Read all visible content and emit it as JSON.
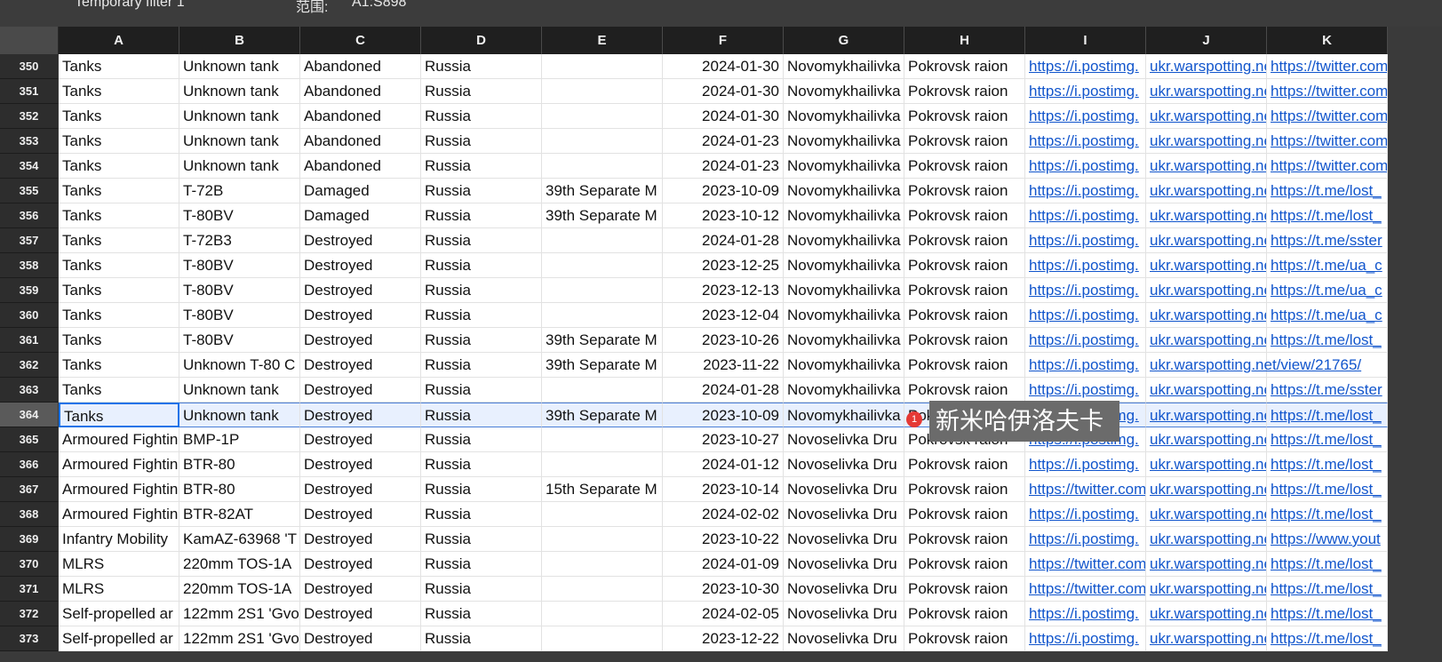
{
  "filter_bar": {
    "filter_name": "Temporary filter 1",
    "range_label": "范围:",
    "range_value": "A1:S898"
  },
  "columns": [
    "A",
    "B",
    "C",
    "D",
    "E",
    "F",
    "G",
    "H",
    "I",
    "J",
    "K"
  ],
  "tooltip": {
    "text": "新米哈伊洛夫卡",
    "badge": "1"
  },
  "rows": [
    {
      "num": "350",
      "cells": [
        "Tanks",
        "Unknown tank",
        "Abandoned",
        "Russia",
        "",
        "2024-01-30",
        "Novomykhailivka",
        "Pokrovsk raion",
        "https://i.postimg.",
        "ukr.warspotting.net",
        "https://twitter.com"
      ]
    },
    {
      "num": "351",
      "cells": [
        "Tanks",
        "Unknown tank",
        "Abandoned",
        "Russia",
        "",
        "2024-01-30",
        "Novomykhailivka",
        "Pokrovsk raion",
        "https://i.postimg.",
        "ukr.warspotting.net",
        "https://twitter.com"
      ]
    },
    {
      "num": "352",
      "cells": [
        "Tanks",
        "Unknown tank",
        "Abandoned",
        "Russia",
        "",
        "2024-01-30",
        "Novomykhailivka",
        "Pokrovsk raion",
        "https://i.postimg.",
        "ukr.warspotting.net",
        "https://twitter.com"
      ]
    },
    {
      "num": "353",
      "cells": [
        "Tanks",
        "Unknown tank",
        "Abandoned",
        "Russia",
        "",
        "2024-01-23",
        "Novomykhailivka",
        "Pokrovsk raion",
        "https://i.postimg.",
        "ukr.warspotting.net",
        "https://twitter.com"
      ]
    },
    {
      "num": "354",
      "cells": [
        "Tanks",
        "Unknown tank",
        "Abandoned",
        "Russia",
        "",
        "2024-01-23",
        "Novomykhailivka",
        "Pokrovsk raion",
        "https://i.postimg.",
        "ukr.warspotting.net",
        "https://twitter.com"
      ]
    },
    {
      "num": "355",
      "cells": [
        "Tanks",
        "T-72B",
        "Damaged",
        "Russia",
        "39th Separate M",
        "2023-10-09",
        "Novomykhailivka",
        "Pokrovsk raion",
        "https://i.postimg.",
        "ukr.warspotting.net",
        "https://t.me/lost_"
      ]
    },
    {
      "num": "356",
      "cells": [
        "Tanks",
        "T-80BV",
        "Damaged",
        "Russia",
        "39th Separate M",
        "2023-10-12",
        "Novomykhailivka",
        "Pokrovsk raion",
        "https://i.postimg.",
        "ukr.warspotting.net",
        "https://t.me/lost_"
      ]
    },
    {
      "num": "357",
      "cells": [
        "Tanks",
        "T-72B3",
        "Destroyed",
        "Russia",
        "",
        "2024-01-28",
        "Novomykhailivka",
        "Pokrovsk raion",
        "https://i.postimg.",
        "ukr.warspotting.net",
        "https://t.me/sster"
      ]
    },
    {
      "num": "358",
      "cells": [
        "Tanks",
        "T-80BV",
        "Destroyed",
        "Russia",
        "",
        "2023-12-25",
        "Novomykhailivka",
        "Pokrovsk raion",
        "https://i.postimg.",
        "ukr.warspotting.net",
        "https://t.me/ua_c"
      ]
    },
    {
      "num": "359",
      "cells": [
        "Tanks",
        "T-80BV",
        "Destroyed",
        "Russia",
        "",
        "2023-12-13",
        "Novomykhailivka",
        "Pokrovsk raion",
        "https://i.postimg.",
        "ukr.warspotting.net",
        "https://t.me/ua_c"
      ]
    },
    {
      "num": "360",
      "cells": [
        "Tanks",
        "T-80BV",
        "Destroyed",
        "Russia",
        "",
        "2023-12-04",
        "Novomykhailivka",
        "Pokrovsk raion",
        "https://i.postimg.",
        "ukr.warspotting.net",
        "https://t.me/ua_c"
      ]
    },
    {
      "num": "361",
      "cells": [
        "Tanks",
        "T-80BV",
        "Destroyed",
        "Russia",
        "39th Separate M",
        "2023-10-26",
        "Novomykhailivka",
        "Pokrovsk raion",
        "https://i.postimg.",
        "ukr.warspotting.net",
        "https://t.me/lost_"
      ]
    },
    {
      "num": "362",
      "cells": [
        "Tanks",
        "Unknown T-80 C",
        "Destroyed",
        "Russia",
        "39th Separate M",
        "2023-11-22",
        "Novomykhailivka",
        "Pokrovsk raion",
        "https://i.postimg.",
        "ukr.warspotting.net/view/21765/",
        ""
      ]
    },
    {
      "num": "363",
      "cells": [
        "Tanks",
        "Unknown tank",
        "Destroyed",
        "Russia",
        "",
        "2024-01-28",
        "Novomykhailivka",
        "Pokrovsk raion",
        "https://i.postimg.",
        "ukr.warspotting.net",
        "https://t.me/sster"
      ]
    },
    {
      "num": "364",
      "cells": [
        "Tanks",
        "Unknown tank",
        "Destroyed",
        "Russia",
        "39th Separate M",
        "2023-10-09",
        "Novomykhailivka",
        "Pokrovsk raion",
        "https://i.postimg.",
        "ukr.warspotting.net",
        "https://t.me/lost_"
      ]
    },
    {
      "num": "365",
      "cells": [
        "Armoured Fightin",
        "BMP-1P",
        "Destroyed",
        "Russia",
        "",
        "2023-10-27",
        "Novoselivka Dru",
        "Pokrovsk raion",
        "https://i.postimg.",
        "ukr.warspotting.net",
        "https://t.me/lost_"
      ]
    },
    {
      "num": "366",
      "cells": [
        "Armoured Fightin",
        "BTR-80",
        "Destroyed",
        "Russia",
        "",
        "2024-01-12",
        "Novoselivka Dru",
        "Pokrovsk raion",
        "https://i.postimg.",
        "ukr.warspotting.net",
        "https://t.me/lost_"
      ]
    },
    {
      "num": "367",
      "cells": [
        "Armoured Fightin",
        "BTR-80",
        "Destroyed",
        "Russia",
        "15th Separate M",
        "2023-10-14",
        "Novoselivka Dru",
        "Pokrovsk raion",
        "https://twitter.com",
        "ukr.warspotting.net",
        "https://t.me/lost_"
      ]
    },
    {
      "num": "368",
      "cells": [
        "Armoured Fightin",
        "BTR-82AT",
        "Destroyed",
        "Russia",
        "",
        "2024-02-02",
        "Novoselivka Dru",
        "Pokrovsk raion",
        "https://i.postimg.",
        "ukr.warspotting.net",
        "https://t.me/lost_"
      ]
    },
    {
      "num": "369",
      "cells": [
        "Infantry Mobility",
        "KamAZ-63968 'T",
        "Destroyed",
        "Russia",
        "",
        "2023-10-22",
        "Novoselivka Dru",
        "Pokrovsk raion",
        "https://i.postimg.",
        "ukr.warspotting.net",
        "https://www.yout"
      ]
    },
    {
      "num": "370",
      "cells": [
        "MLRS",
        "220mm TOS-1A",
        "Destroyed",
        "Russia",
        "",
        "2024-01-09",
        "Novoselivka Dru",
        "Pokrovsk raion",
        "https://twitter.com",
        "ukr.warspotting.net",
        "https://t.me/lost_"
      ]
    },
    {
      "num": "371",
      "cells": [
        "MLRS",
        "220mm TOS-1A",
        "Destroyed",
        "Russia",
        "",
        "2023-10-30",
        "Novoselivka Dru",
        "Pokrovsk raion",
        "https://twitter.com",
        "ukr.warspotting.net",
        "https://t.me/lost_"
      ]
    },
    {
      "num": "372",
      "cells": [
        "Self-propelled ar",
        "122mm 2S1 'Gvo",
        "Destroyed",
        "Russia",
        "",
        "2024-02-05",
        "Novoselivka Dru",
        "Pokrovsk raion",
        "https://i.postimg.",
        "ukr.warspotting.net",
        "https://t.me/lost_"
      ]
    },
    {
      "num": "373",
      "cells": [
        "Self-propelled ar",
        "122mm 2S1 'Gvo",
        "Destroyed",
        "Russia",
        "",
        "2023-12-22",
        "Novoselivka Dru",
        "Pokrovsk raion",
        "https://i.postimg.",
        "ukr.warspotting.net",
        "https://t.me/lost_"
      ]
    }
  ]
}
